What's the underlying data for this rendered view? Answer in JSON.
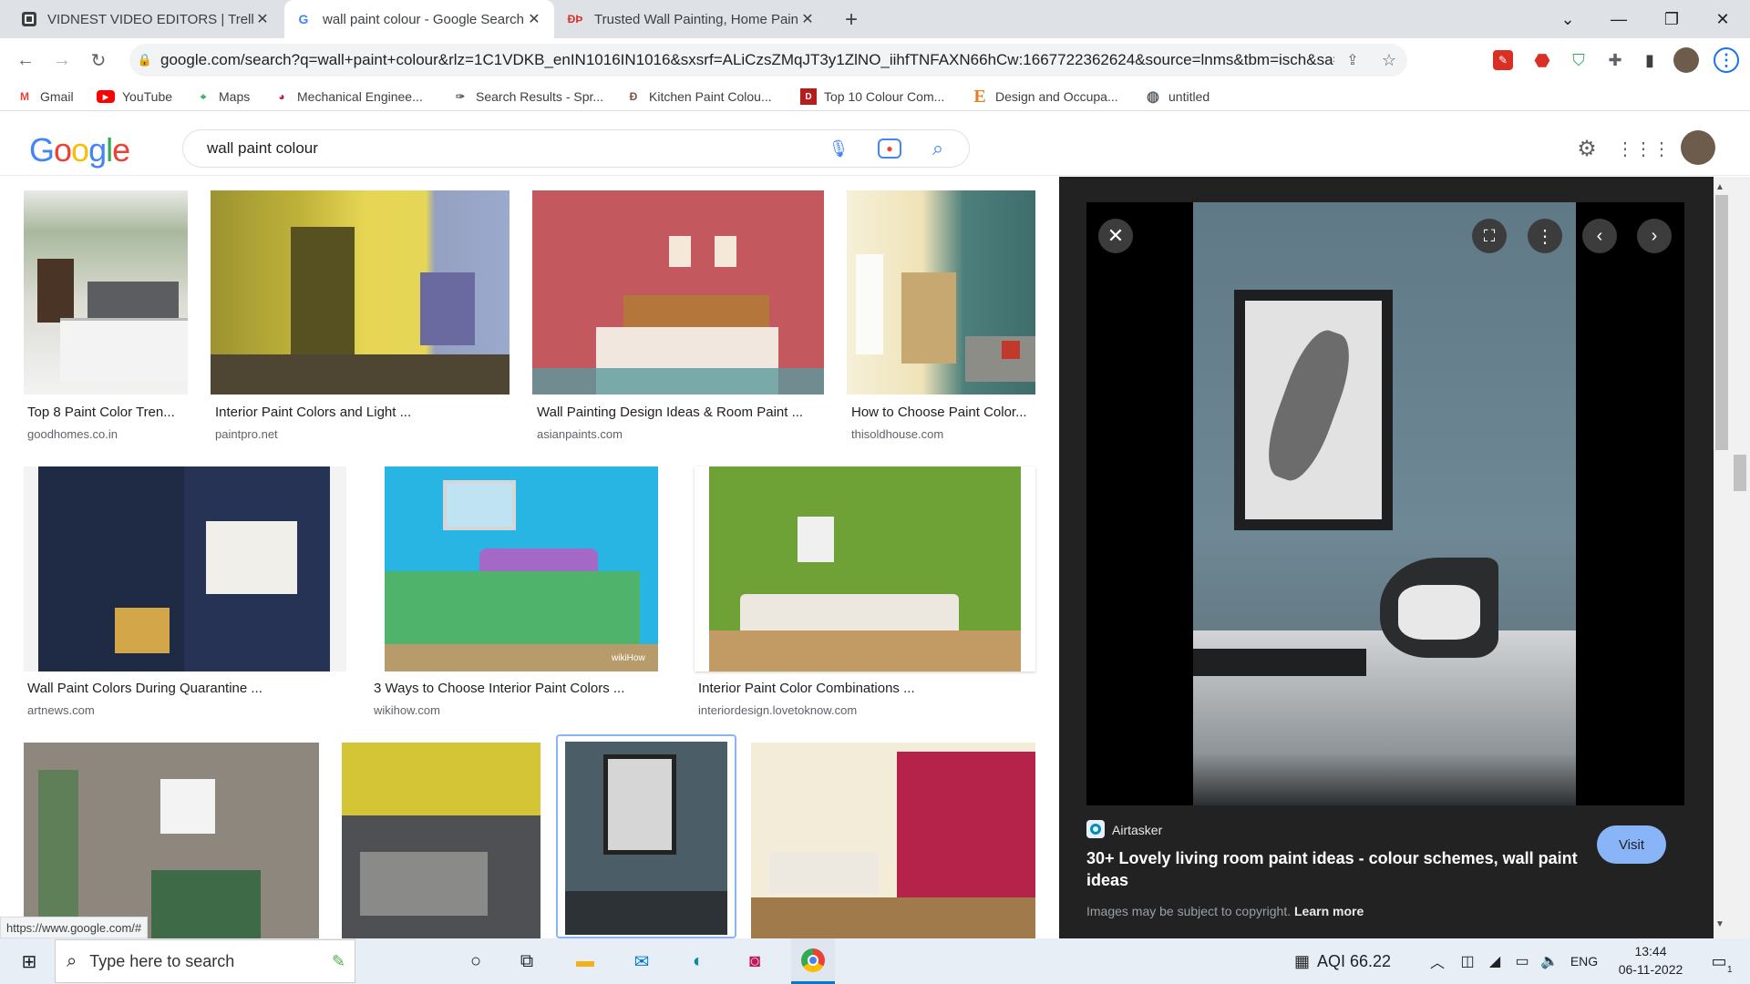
{
  "tabs": [
    {
      "title": "VIDNEST VIDEO EDITORS | Trello",
      "icon": "trello-icon"
    },
    {
      "title": "wall paint colour - Google Search",
      "icon": "google-icon"
    },
    {
      "title": "Trusted Wall Painting, Home Pain",
      "icon": "site-icon"
    }
  ],
  "url": "google.com/search?q=wall+paint+colour&rlz=1C1VDKB_enIN1016IN1016&sxsrf=ALiCzsZMqJT3y1ZlNO_iihfTNFAXN66hCw:1667722362624&source=lnms&tbm=isch&sa=X&...",
  "bookmarks": [
    "Gmail",
    "YouTube",
    "Maps",
    "Mechanical Enginee...",
    "Search Results - Spr...",
    "Kitchen Paint Colou...",
    "Top 10 Colour Com...",
    "Design and Occupa...",
    "untitled"
  ],
  "search": {
    "query": "wall paint colour",
    "logo": "Google"
  },
  "results": [
    {
      "title": "Top 8 Paint Color Tren...",
      "source": "goodhomes.co.in"
    },
    {
      "title": "Interior Paint Colors and Light ...",
      "source": "paintpro.net"
    },
    {
      "title": "Wall Painting Design Ideas & Room Paint ...",
      "source": "asianpaints.com"
    },
    {
      "title": "How to Choose Paint Color...",
      "source": "thisoldhouse.com"
    },
    {
      "title": "Wall Paint Colors During Quarantine ...",
      "source": "artnews.com"
    },
    {
      "title": "3 Ways to Choose Interior Paint Colors ...",
      "source": "wikihow.com"
    },
    {
      "title": "Interior Paint Color Combinations ...",
      "source": "interiordesign.lovetoknow.com"
    }
  ],
  "watermark": "wikiHow",
  "preview": {
    "site": "Airtasker",
    "title": "30+ Lovely living room paint ideas - colour schemes, wall paint ideas",
    "visit": "Visit",
    "copyright": "Images may be subject to copyright.",
    "learn_more": "Learn more"
  },
  "status_url": "https://www.google.com/#",
  "taskbar": {
    "search_placeholder": "Type here to search",
    "aqi": "AQI 66.22",
    "lang": "ENG",
    "time": "13:44",
    "date": "06-11-2022",
    "notif": "1"
  },
  "colors": {
    "accent": "#1a73e8",
    "visit_btn": "#8ab4f8",
    "panel_bg": "#222222"
  }
}
